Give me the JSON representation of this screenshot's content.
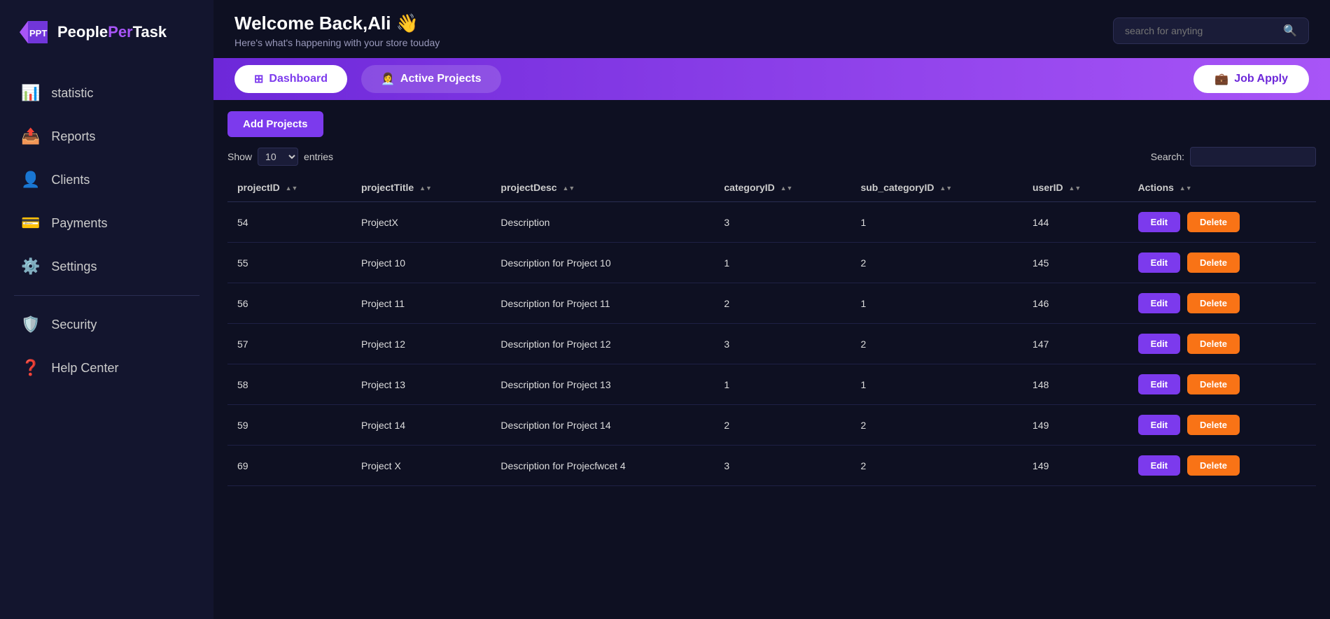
{
  "app": {
    "name": "PeoplePerTask",
    "logo_color": "#a855f7"
  },
  "header": {
    "welcome": "Welcome Back,Ali 👋",
    "subtitle": "Here's what's happening with your store touday",
    "search_placeholder": "search for anyting"
  },
  "tabs": {
    "dashboard_label": "Dashboard",
    "active_projects_label": "Active Projects",
    "job_apply_label": "Job Apply"
  },
  "sidebar": {
    "items": [
      {
        "label": "statistic",
        "icon": "📊"
      },
      {
        "label": "Reports",
        "icon": "📤"
      },
      {
        "label": "Clients",
        "icon": "👤"
      },
      {
        "label": "Payments",
        "icon": "💳"
      },
      {
        "label": "Settings",
        "icon": "⚙️"
      },
      {
        "label": "Security",
        "icon": "🛡️"
      },
      {
        "label": "Help Center",
        "icon": "❓"
      }
    ]
  },
  "content": {
    "add_projects_label": "Add Projects",
    "show_label": "Show",
    "entries_label": "entries",
    "search_label": "Search:",
    "entries_count": "10",
    "columns": [
      "projectID",
      "projectTitle",
      "projectDesc",
      "categoryID",
      "sub_categoryID",
      "userID",
      "Actions"
    ],
    "rows": [
      {
        "id": "54",
        "title": "ProjectX",
        "desc": "Description",
        "categoryID": "3",
        "sub_categoryID": "1",
        "userID": "144"
      },
      {
        "id": "55",
        "title": "Project 10",
        "desc": "Description for Project 10",
        "categoryID": "1",
        "sub_categoryID": "2",
        "userID": "145"
      },
      {
        "id": "56",
        "title": "Project 11",
        "desc": "Description for Project 11",
        "categoryID": "2",
        "sub_categoryID": "1",
        "userID": "146"
      },
      {
        "id": "57",
        "title": "Project 12",
        "desc": "Description for Project 12",
        "categoryID": "3",
        "sub_categoryID": "2",
        "userID": "147"
      },
      {
        "id": "58",
        "title": "Project 13",
        "desc": "Description for Project 13",
        "categoryID": "1",
        "sub_categoryID": "1",
        "userID": "148"
      },
      {
        "id": "59",
        "title": "Project 14",
        "desc": "Description for Project 14",
        "categoryID": "2",
        "sub_categoryID": "2",
        "userID": "149"
      },
      {
        "id": "69",
        "title": "Project X",
        "desc": "Description for Projecfwcet 4",
        "categoryID": "3",
        "sub_categoryID": "2",
        "userID": "149"
      }
    ],
    "edit_label": "Edit",
    "delete_label": "Delete"
  }
}
